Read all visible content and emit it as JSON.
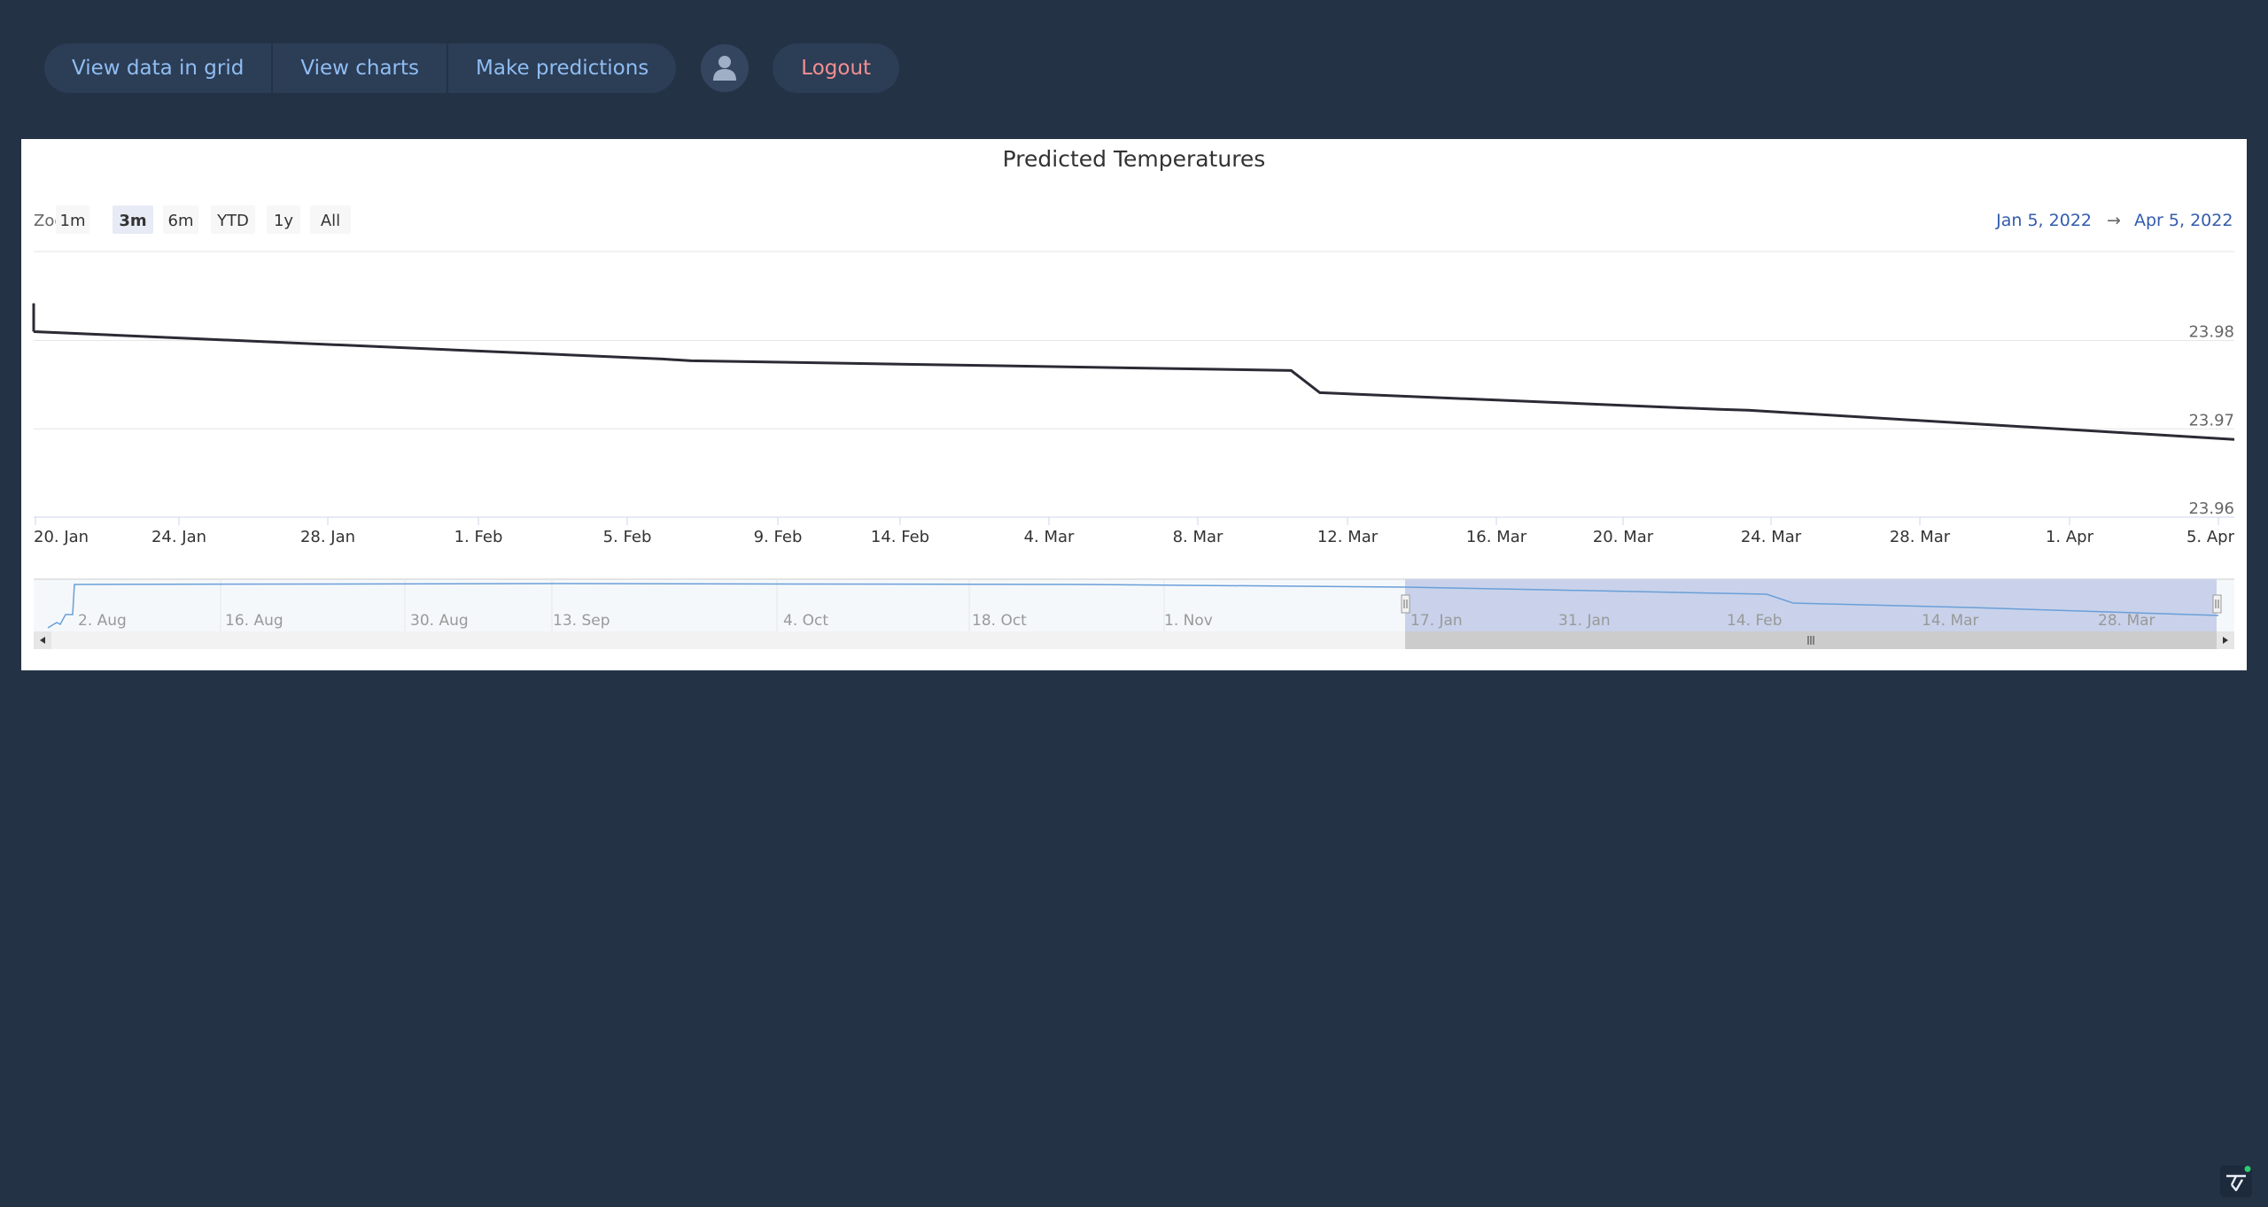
{
  "nav": {
    "grid_label": "View data in grid",
    "charts_label": "View charts",
    "predict_label": "Make predictions",
    "logout_label": "Logout"
  },
  "chart": {
    "zoom_label": "Zoom",
    "zoom_buttons": [
      "1m",
      "3m",
      "6m",
      "YTD",
      "1y",
      "All"
    ],
    "zoom_selected": "3m",
    "range_from": "Jan 5, 2022",
    "range_arrow": "→",
    "range_to": "Apr 5, 2022",
    "navigator_labels": [
      "2. Aug",
      "16. Aug",
      "30. Aug",
      "13. Sep",
      "4. Oct",
      "18. Oct",
      "1. Nov",
      "17. Jan",
      "31. Jan",
      "14. Feb",
      "14. Mar",
      "28. Mar"
    ],
    "colors": {
      "series": "#2b2b35",
      "navigator_line": "#6a9fd8",
      "range_text": "#335cad",
      "background": "#243246"
    }
  },
  "chart_data": {
    "type": "line",
    "title": "Predicted Temperatures",
    "x": [
      "2022-01-18",
      "2022-02-09",
      "2022-02-10",
      "2022-03-03",
      "2022-03-04",
      "2022-03-18",
      "2022-03-19",
      "2022-04-05"
    ],
    "series": [
      {
        "values": [
          23.981,
          23.9779,
          23.9777,
          23.9766,
          23.9741,
          23.9722,
          23.9721,
          23.9688
        ]
      }
    ],
    "x_tick_labels": [
      "20. Jan",
      "24. Jan",
      "28. Jan",
      "1. Feb",
      "5. Feb",
      "9. Feb",
      "14. Feb",
      "4. Mar",
      "8. Mar",
      "12. Mar",
      "16. Mar",
      "20. Mar",
      "24. Mar",
      "28. Mar",
      "1. Apr",
      "5. Apr"
    ],
    "y_tick_labels": [
      "23.98",
      "23.97",
      "23.96"
    ],
    "ylim": [
      23.96,
      23.98
    ],
    "grid": true,
    "legend": "none"
  }
}
